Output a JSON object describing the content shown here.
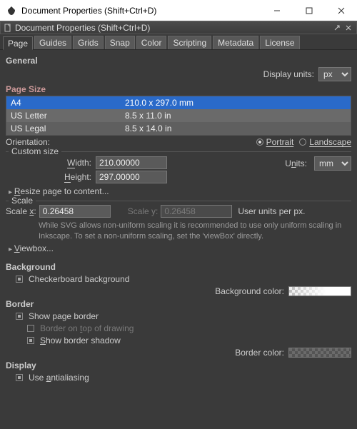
{
  "win": {
    "title": "Document Properties (Shift+Ctrl+D)"
  },
  "innerTitle": "Document Properties (Shift+Ctrl+D)",
  "tabs": [
    "Page",
    "Guides",
    "Grids",
    "Snap",
    "Color",
    "Scripting",
    "Metadata",
    "License"
  ],
  "activeTab": 0,
  "general": {
    "title": "General",
    "displayUnitsLabel": "Display units:",
    "displayUnits": "px"
  },
  "pageSize": {
    "title": "Page Size",
    "rows": [
      {
        "name": "A4",
        "dim": "210.0 x 297.0 mm"
      },
      {
        "name": "US Letter",
        "dim": "8.5 x 11.0 in"
      },
      {
        "name": "US Legal",
        "dim": "8.5 x 14.0 in"
      }
    ],
    "orientationLabel": "Orientation:",
    "portrait": "Portrait",
    "landscape": "Landscape",
    "custom": {
      "legend": "Custom size",
      "widthLabel": "Width:",
      "heightLabel": "Height:",
      "width": "210.00000",
      "height": "297.00000",
      "unitsLabel": "Units:",
      "units": "mm"
    },
    "resizeExpander": "Resize page to content..."
  },
  "scale": {
    "legend": "Scale",
    "sxLabel": "Scale x:",
    "sx": "0.26458",
    "syLabel": "Scale y:",
    "sy": "0.26458",
    "unitNote": "User units per px.",
    "help": "While SVG allows non-uniform scaling it is recommended to use only uniform scaling in Inkscape. To set a non-uniform scaling, set the 'viewBox' directly.",
    "viewboxExpander": "Viewbox..."
  },
  "background": {
    "title": "Background",
    "checkerLabel": "Checkerboard background",
    "colorLabel": "Background color:"
  },
  "border": {
    "title": "Border",
    "showPage": "Show page border",
    "onTop": "Border on top of drawing",
    "shadow": "Show border shadow",
    "colorLabel": "Border color:"
  },
  "display": {
    "title": "Display",
    "aa": "Use antialiasing"
  }
}
